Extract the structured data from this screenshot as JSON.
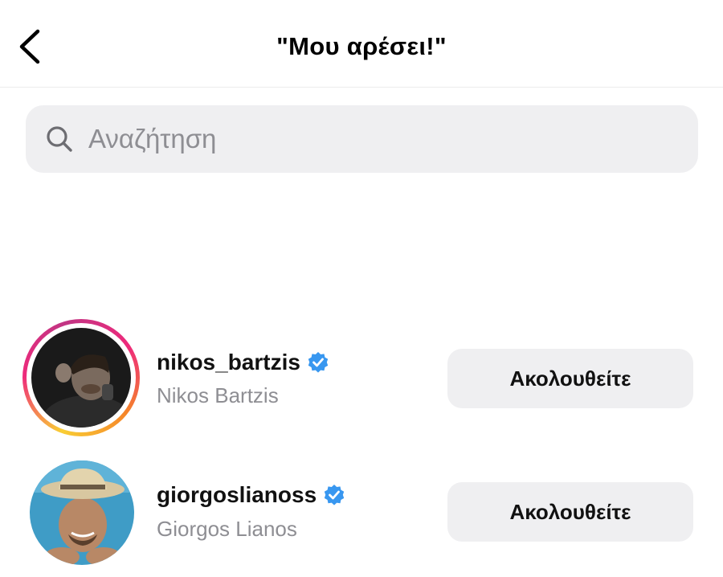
{
  "header": {
    "title": "\"Μου αρέσει!\""
  },
  "search": {
    "placeholder": "Αναζήτηση",
    "value": ""
  },
  "users": [
    {
      "username": "nikos_bartzis",
      "full_name": "Nikos Bartzis",
      "verified": true,
      "has_story_ring": true,
      "button_label": "Ακολουθείτε"
    },
    {
      "username": "giorgoslianoss",
      "full_name": "Giorgos Lianos",
      "verified": true,
      "has_story_ring": false,
      "button_label": "Ακολουθείτε"
    }
  ],
  "colors": {
    "verified_badge": "#3897f0",
    "button_bg": "#efeff1",
    "secondary_text": "#8e8e93"
  }
}
